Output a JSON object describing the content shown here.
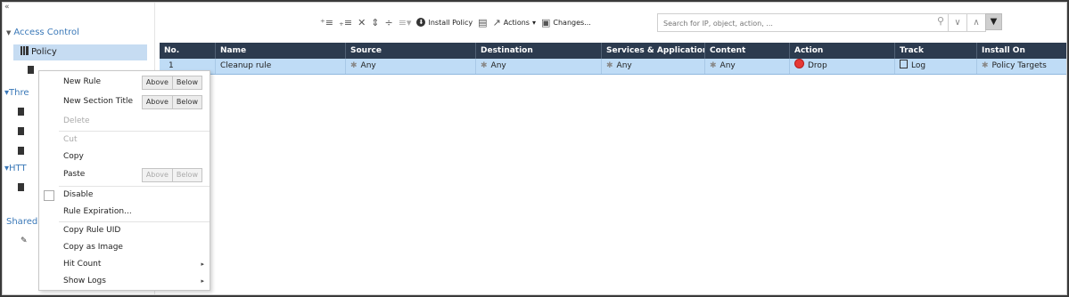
{
  "sidebar": {
    "collapse_glyph": "«",
    "access_control": "Access Control",
    "policy": "Policy",
    "threat_stub": "Thre",
    "https_stub": "HTT",
    "shared": "Shared",
    "link_color": "#3a78b8",
    "selected_bg": "#c6dcf2"
  },
  "toolbar": {
    "install_policy": "Install Policy",
    "actions": "Actions",
    "changes": "Changes...",
    "search_placeholder": "Search for IP, object, action, ..."
  },
  "table": {
    "columns": [
      "No.",
      "Name",
      "Source",
      "Destination",
      "Services & Applications",
      "Content",
      "Action",
      "Track",
      "Install On"
    ],
    "rows": [
      {
        "no": "1",
        "name": "Cleanup rule",
        "source": "Any",
        "destination": "Any",
        "services": "Any",
        "content": "Any",
        "action": "Drop",
        "track": "Log",
        "install_on": "Policy Targets"
      }
    ],
    "header_bg": "#2c3b4f",
    "row_bg": "#bfdcf6"
  },
  "context_menu": {
    "new_rule": "New Rule",
    "new_section_title": "New Section Title",
    "above": "Above",
    "below": "Below",
    "delete": "Delete",
    "cut": "Cut",
    "copy": "Copy",
    "paste": "Paste",
    "disable": "Disable",
    "rule_expiration": "Rule Expiration...",
    "copy_rule_uid": "Copy Rule UID",
    "copy_as_image": "Copy as Image",
    "hit_count": "Hit Count",
    "show_logs": "Show Logs"
  },
  "colors": {
    "drop_red": "#e53935"
  }
}
